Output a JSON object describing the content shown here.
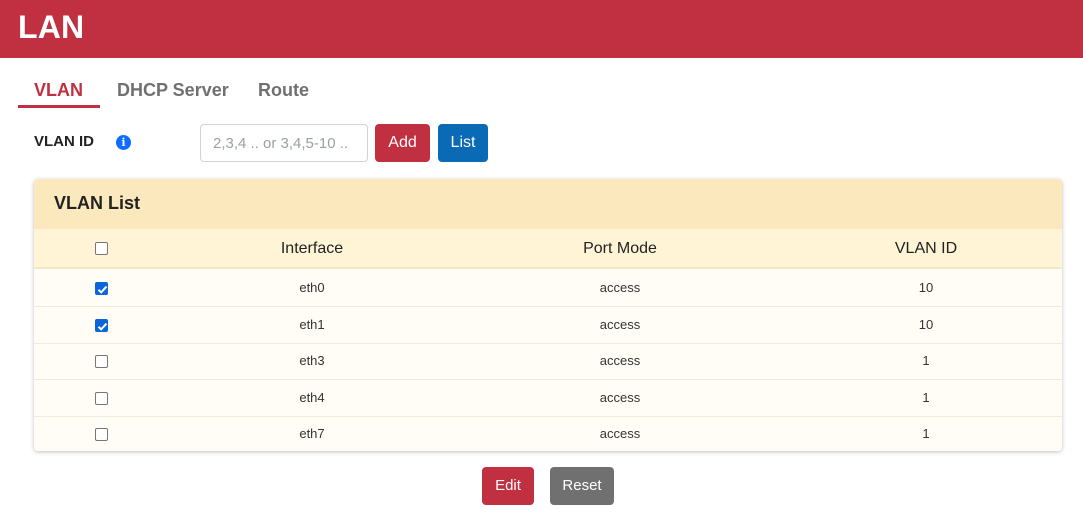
{
  "header": {
    "title": "LAN"
  },
  "tabs": [
    {
      "label": "VLAN",
      "active": true
    },
    {
      "label": "DHCP Server",
      "active": false
    },
    {
      "label": "Route",
      "active": false
    }
  ],
  "vlan_form": {
    "label": "VLAN ID",
    "info_icon": "info-circle-icon",
    "placeholder": "2,3,4 .. or 3,4,5-10 ..",
    "value": "",
    "add_label": "Add",
    "list_label": "List"
  },
  "vlan_list": {
    "title": "VLAN List",
    "columns": [
      "Interface",
      "Port Mode",
      "VLAN ID"
    ],
    "select_all_checked": false,
    "rows": [
      {
        "checked": true,
        "interface": "eth0",
        "port_mode": "access",
        "vlan_id": "10"
      },
      {
        "checked": true,
        "interface": "eth1",
        "port_mode": "access",
        "vlan_id": "10"
      },
      {
        "checked": false,
        "interface": "eth3",
        "port_mode": "access",
        "vlan_id": "1"
      },
      {
        "checked": false,
        "interface": "eth4",
        "port_mode": "access",
        "vlan_id": "1"
      },
      {
        "checked": false,
        "interface": "eth7",
        "port_mode": "access",
        "vlan_id": "1"
      }
    ]
  },
  "actions": {
    "edit_label": "Edit",
    "reset_label": "Reset"
  },
  "colors": {
    "brand": "#c03040",
    "primary": "#0a6ab6",
    "secondary": "#707070",
    "card_header": "#fbe8bc",
    "checkbox": "#0a66d8"
  }
}
